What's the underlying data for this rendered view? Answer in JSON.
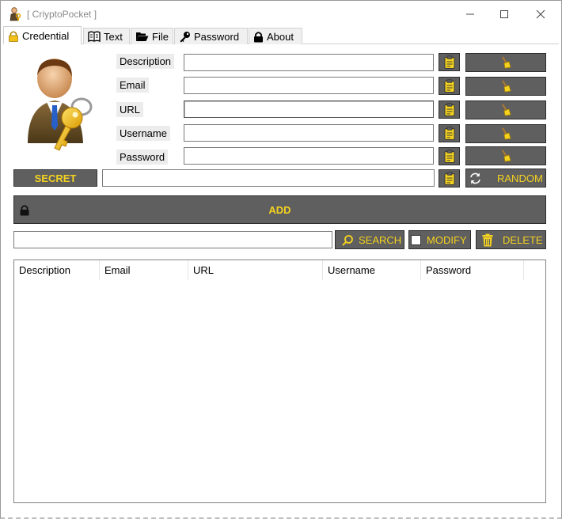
{
  "window": {
    "title": "[ CriyptoPocket ]",
    "controls": {
      "minimize": "minimize-icon",
      "maximize": "maximize-icon",
      "close": "close-icon"
    }
  },
  "tabs": [
    {
      "label": "Credential",
      "icon": "lock-icon",
      "active": true
    },
    {
      "label": "Text",
      "icon": "book-icon",
      "active": false
    },
    {
      "label": "File",
      "icon": "folder-icon",
      "active": false
    },
    {
      "label": "Password",
      "icon": "key-icon",
      "active": false
    },
    {
      "label": "About",
      "icon": "lock-icon",
      "active": false
    }
  ],
  "form": {
    "fields": [
      {
        "label": "Description",
        "value": ""
      },
      {
        "label": "Email",
        "value": ""
      },
      {
        "label": "URL",
        "value": ""
      },
      {
        "label": "Username",
        "value": ""
      },
      {
        "label": "Password",
        "value": ""
      }
    ],
    "secret_label": "SECRET",
    "secret_value": "",
    "random_label": "RANDOM",
    "add_label": "ADD"
  },
  "toolbar": {
    "search_value": "",
    "search_label": "SEARCH",
    "modify_label": "MODIFY",
    "modify_checked": false,
    "delete_label": "DELETE"
  },
  "list": {
    "columns": [
      "Description",
      "Email",
      "URL",
      "Username",
      "Password"
    ],
    "rows": []
  },
  "colors": {
    "button_bg": "#5f5f5f",
    "button_text": "#f4d21f",
    "border": "#7a7a7a"
  }
}
